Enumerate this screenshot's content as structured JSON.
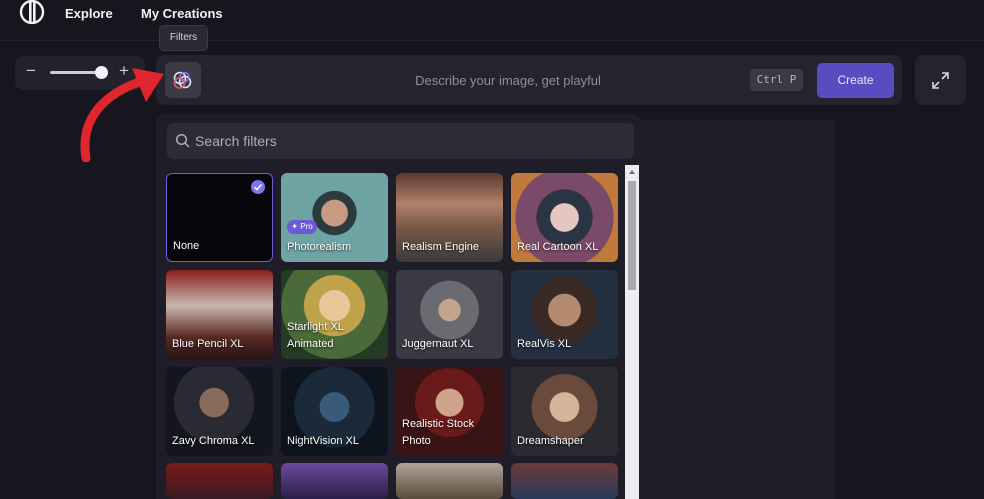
{
  "nav": {
    "explore": "Explore",
    "my_creations": "My Creations"
  },
  "zoom": {
    "minus": "−",
    "plus": "+",
    "level": 0.9
  },
  "tooltip": "Filters",
  "prompt": {
    "placeholder": "Describe your image, get playful",
    "shortcut": "Ctrl P",
    "create_label": "Create"
  },
  "filters": {
    "search_placeholder": "Search filters",
    "items": [
      {
        "label": "None",
        "selected": true
      },
      {
        "label": "Photorealism",
        "badge": "Pro"
      },
      {
        "label": "Realism Engine"
      },
      {
        "label": "Real Cartoon XL"
      },
      {
        "label": "Blue Pencil XL"
      },
      {
        "label_line1": "Starlight XL",
        "label_line2": "Animated"
      },
      {
        "label": "Juggernaut XL"
      },
      {
        "label": "RealVis XL"
      },
      {
        "label": "Zavy Chroma XL"
      },
      {
        "label": "NightVision XL"
      },
      {
        "label_line1": "Realistic Stock",
        "label_line2": "Photo"
      },
      {
        "label": "Dreamshaper"
      }
    ]
  },
  "icons": {
    "logo": "app-logo-icon",
    "search": "search-icon",
    "filter": "filter-icon",
    "expand": "expand-icon",
    "check": "check-icon",
    "arrow": "red-arrow-annotation"
  },
  "colors": {
    "accent": "#5b4bc0",
    "arrow": "#e0262d",
    "background": "#17161f",
    "panel": "#24232e"
  }
}
